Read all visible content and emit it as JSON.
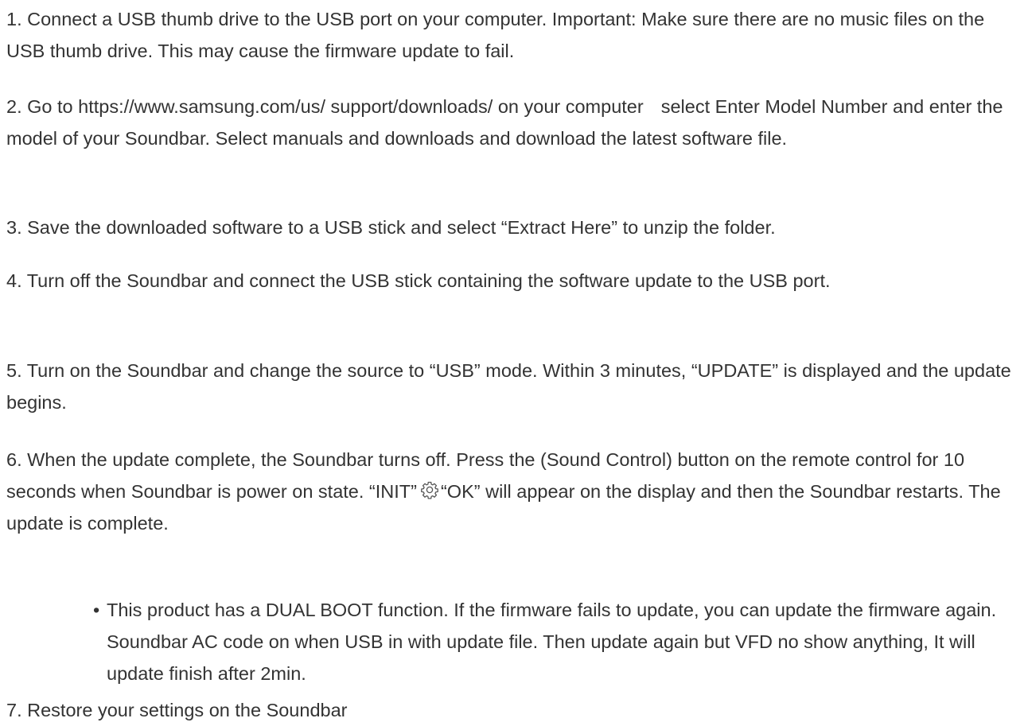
{
  "steps": {
    "s1": "1. Connect a USB thumb drive to the USB port on your computer. Important: Make sure there are no music files on the USB thumb drive. This may cause the firmware update to fail.",
    "s2a": "2. Go to https://www.samsung.com/us/ support/downloads/ on your computer",
    "s2b": "select Enter Model Number and enter the model of your Soundbar. Select manuals and downloads and download the latest software file.",
    "s3": "3. Save the downloaded software to a USB stick and select “Extract Here” to unzip the folder.",
    "s4": "4. Turn off the Soundbar and connect the USB stick containing the software update to the USB port.",
    "s5": "5. Turn on the Soundbar and change the source to “USB” mode. Within 3 minutes, “UPDATE” is displayed and the update begins.",
    "s6a": "6. When the update complete, the Soundbar turns off. Press the (Sound Control) button on the remote control for 10 seconds when Soundbar is power on state. “INIT”",
    "s6b": "“OK” will appear on the display and then the Soundbar restarts. The update is complete.",
    "s7": "7. Restore your settings on the Soundbar"
  },
  "note": {
    "bullet": "•",
    "text": "This product has a DUAL BOOT function. If the firmware fails to update, you can update the firmware again. Soundbar AC code on when USB in with update file. Then update again but VFD no show anything, It will update finish after 2min."
  },
  "icons": {
    "step6_icon": "gear-icon"
  },
  "colors": {
    "text": "#333333",
    "background": "#ffffff"
  }
}
